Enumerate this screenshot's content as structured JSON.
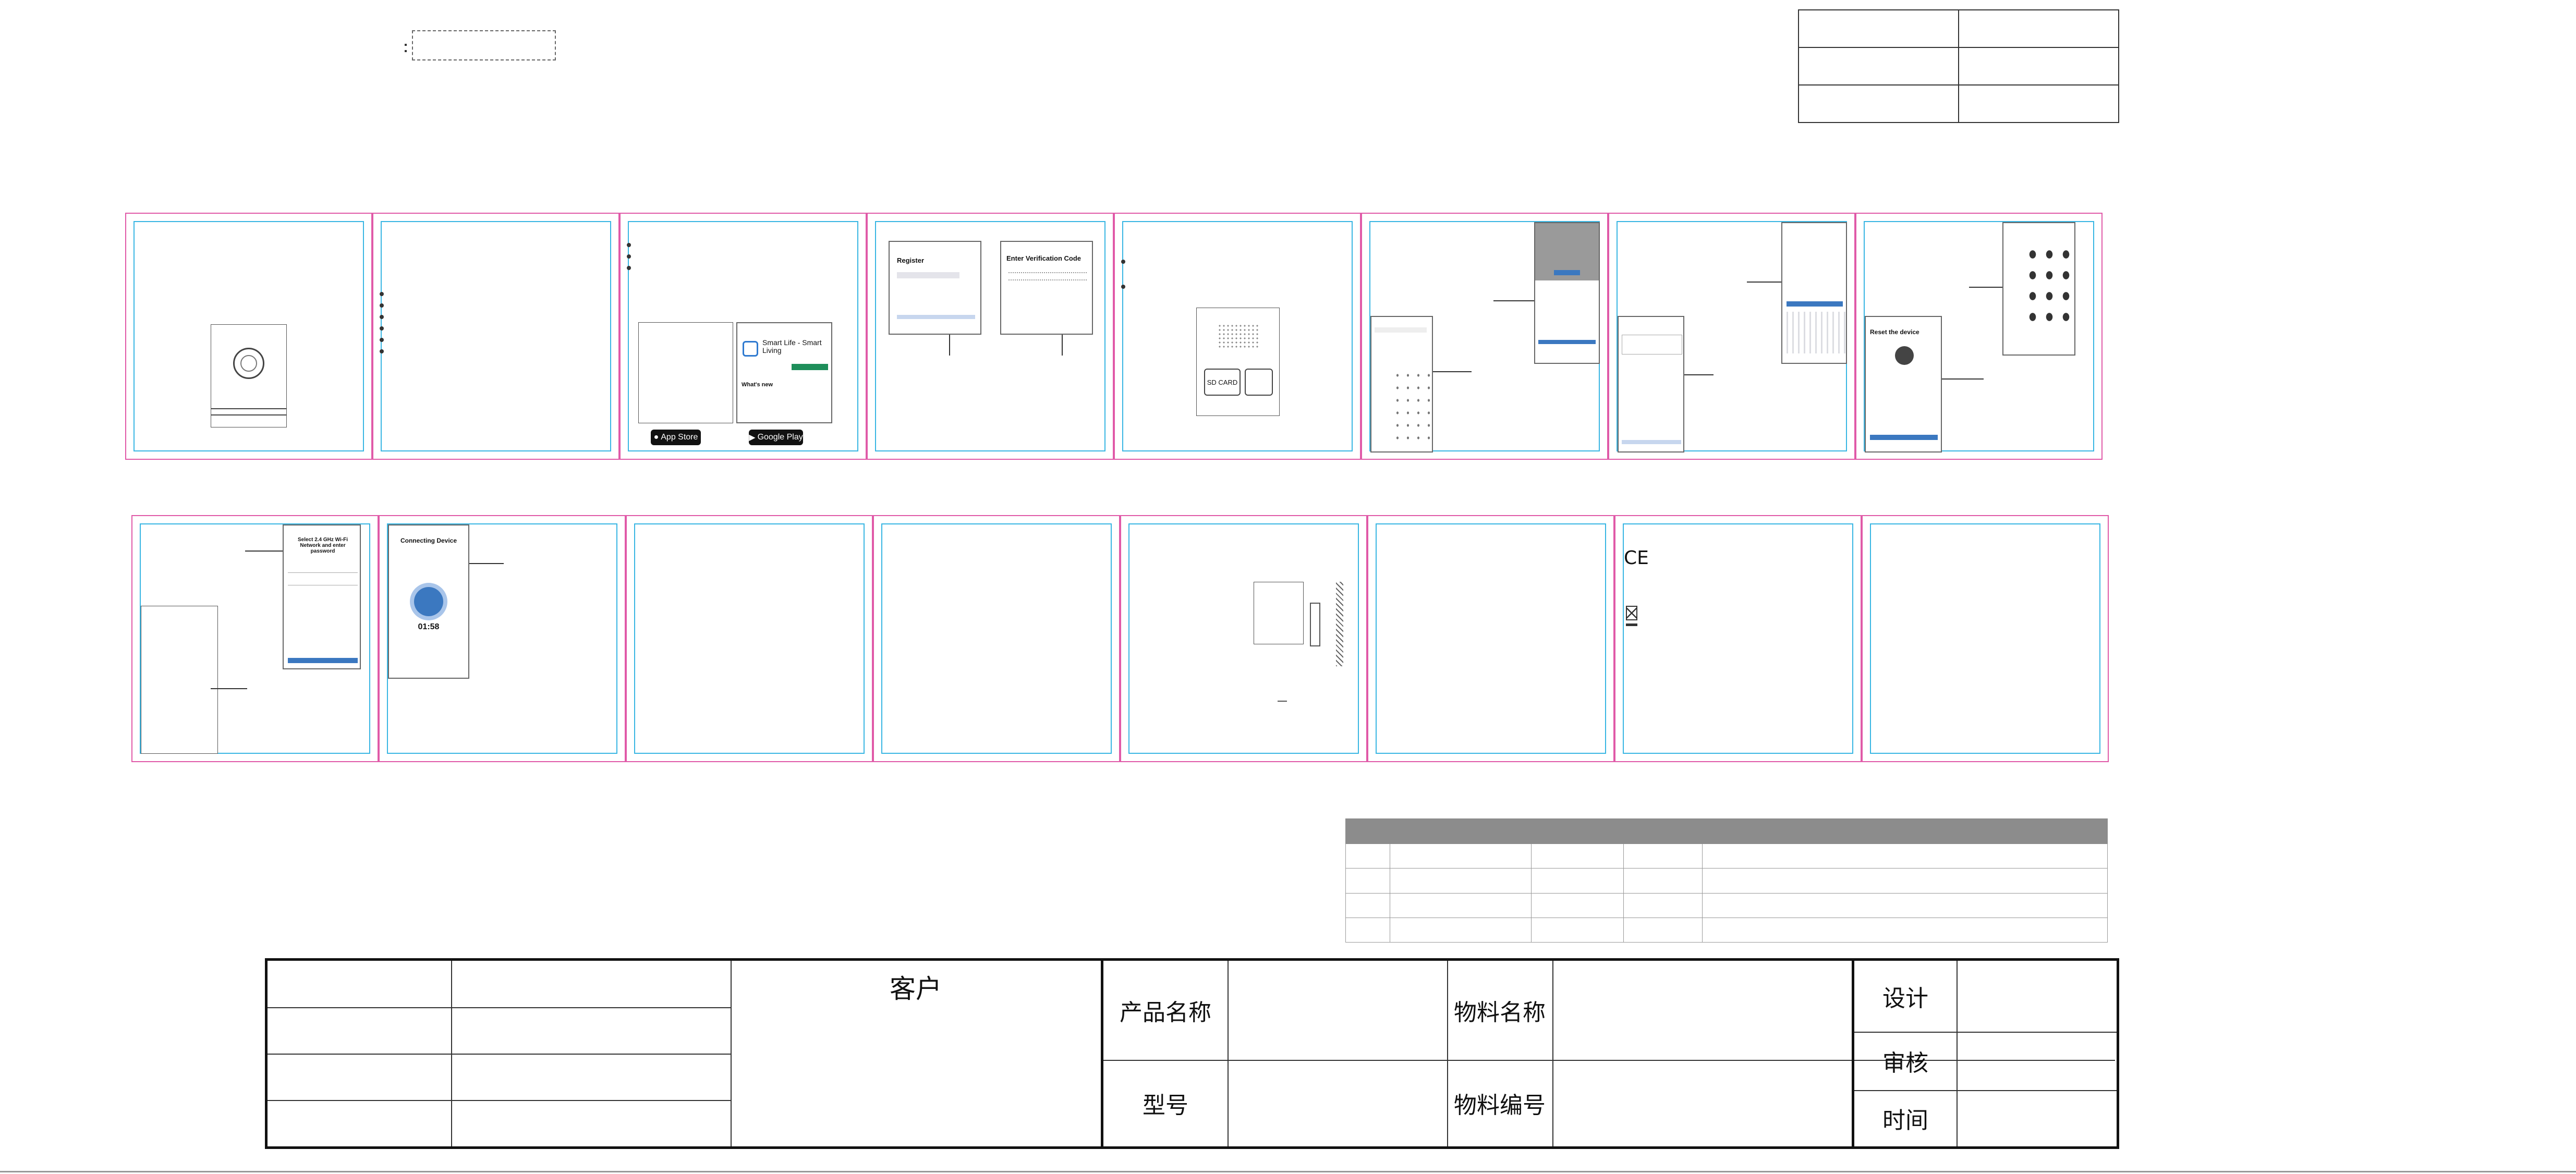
{
  "labels_table": {
    "customer": "客户",
    "product_name": "产品名称",
    "material_name": "物料名称",
    "model": "型号",
    "material_no": "物料编号",
    "design": "设计",
    "review": "审核",
    "time": "时间"
  },
  "panel_texts": {
    "register_title": "Register",
    "verification_title": "Enter Verification Code",
    "app_title": "Smart Life - Smart Living",
    "whats_new": "What's new",
    "app_store_badge": "App Store",
    "google_play_badge": "Google Play",
    "sd_card_label": "SD CARD",
    "connecting_title": "Connecting Device",
    "countdown": "01:58",
    "reset_title": "Reset the device",
    "wifi_title": "Select 2.4 GHz Wi-Fi Network and enter password",
    "ce_mark": "CE"
  },
  "colors": {
    "panel_border": "#e05aa8",
    "inner_border": "#39b6e3",
    "accent_blue": "#3b78c0",
    "header_grey": "#8c8c8c"
  }
}
